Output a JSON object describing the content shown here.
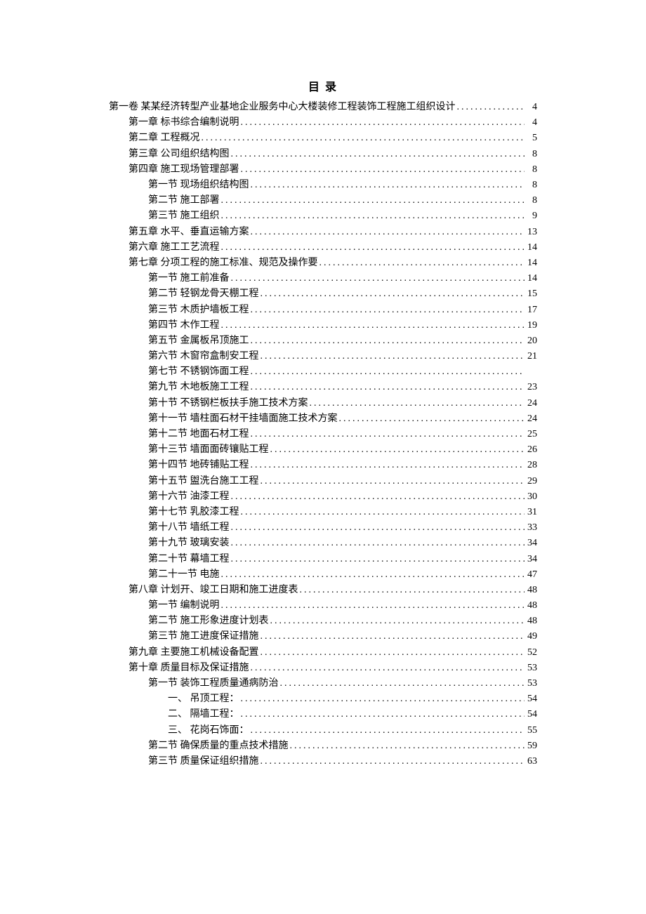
{
  "title": "目 录",
  "entries": [
    {
      "indent": 0,
      "label": "第一卷 某某经济转型产业基地企业服务中心大楼装修工程装饰工程施工组织设计",
      "page": "4"
    },
    {
      "indent": 1,
      "label": "第一章 标书综合编制说明",
      "page": "4"
    },
    {
      "indent": 1,
      "label": "第二章 工程概况",
      "page": "5"
    },
    {
      "indent": 1,
      "label": "第三章 公司组织结构图",
      "page": "8"
    },
    {
      "indent": 1,
      "label": "第四章 施工现场管理部署",
      "page": "8"
    },
    {
      "indent": 2,
      "label": "第一节 现场组织结构图",
      "page": "8"
    },
    {
      "indent": 2,
      "label": "第二节 施工部署",
      "page": "8"
    },
    {
      "indent": 2,
      "label": "第三节 施工组织",
      "page": "9"
    },
    {
      "indent": 1,
      "label": "第五章 水平、垂直运输方案",
      "page": "13"
    },
    {
      "indent": 1,
      "label": "第六章 施工工艺流程",
      "page": "14"
    },
    {
      "indent": 1,
      "label": "第七章 分项工程的施工标准、规范及操作要",
      "page": "14"
    },
    {
      "indent": 2,
      "label": "第一节 施工前准备",
      "page": "14"
    },
    {
      "indent": 2,
      "label": "第二节 轻钢龙骨天棚工程",
      "page": "15"
    },
    {
      "indent": 2,
      "label": "第三节 木质护墙板工程",
      "page": "17"
    },
    {
      "indent": 2,
      "label": "第四节 木作工程",
      "page": "19"
    },
    {
      "indent": 2,
      "label": "第五节 金属板吊顶施工",
      "page": "20"
    },
    {
      "indent": 2,
      "label": "第六节 木窗帘盒制安工程",
      "page": "21"
    },
    {
      "indent": 2,
      "label": "第七节 不锈钢饰面工程",
      "page": ""
    },
    {
      "indent": 2,
      "label": "第九节 木地板施工工程",
      "page": "23"
    },
    {
      "indent": 2,
      "label": "第十节 不锈钢栏板扶手施工技术方案",
      "page": "24"
    },
    {
      "indent": 2,
      "label": "第十一节 墙柱面石材干挂墙面施工技术方案",
      "page": "24"
    },
    {
      "indent": 2,
      "label": "第十二节 地面石材工程",
      "page": "25"
    },
    {
      "indent": 2,
      "label": "第十三节 墙面面砖镶贴工程",
      "page": "26"
    },
    {
      "indent": 2,
      "label": "第十四节 地砖铺贴工程",
      "page": "28"
    },
    {
      "indent": 2,
      "label": "第十五节 盥洗台施工工程",
      "page": "29"
    },
    {
      "indent": 2,
      "label": "第十六节 油漆工程",
      "page": "30"
    },
    {
      "indent": 2,
      "label": "第十七节 乳胶漆工程",
      "page": "31"
    },
    {
      "indent": 2,
      "label": "第十八节 墙纸工程",
      "page": "33"
    },
    {
      "indent": 2,
      "label": "第十九节 玻璃安装",
      "page": "34"
    },
    {
      "indent": 2,
      "label": "第二十节 幕墙工程",
      "page": "34"
    },
    {
      "indent": 2,
      "label": "第二十一节 电施",
      "page": "47"
    },
    {
      "indent": 1,
      "label": "第八章 计划开、竣工日期和施工进度表",
      "page": "48"
    },
    {
      "indent": 2,
      "label": "第一节 编制说明",
      "page": "48"
    },
    {
      "indent": 2,
      "label": "第二节 施工形象进度计划表",
      "page": "48"
    },
    {
      "indent": 2,
      "label": "第三节 施工进度保证措施",
      "page": "49"
    },
    {
      "indent": 1,
      "label": "第九章 主要施工机械设备配置",
      "page": "52"
    },
    {
      "indent": 1,
      "label": "第十章 质量目标及保证措施",
      "page": "53"
    },
    {
      "indent": 2,
      "label": "第一节 装饰工程质量通病防治",
      "page": "53"
    },
    {
      "indent": 3,
      "label": "一、 吊顶工程：",
      "page": "54"
    },
    {
      "indent": 3,
      "label": "二、 隔墙工程：",
      "page": "54"
    },
    {
      "indent": 3,
      "label": "三、 花岗石饰面：",
      "page": "55"
    },
    {
      "indent": 2,
      "label": "第二节 确保质量的重点技术措施",
      "page": "59"
    },
    {
      "indent": 2,
      "label": "第三节 质量保证组织措施",
      "page": "63"
    }
  ]
}
